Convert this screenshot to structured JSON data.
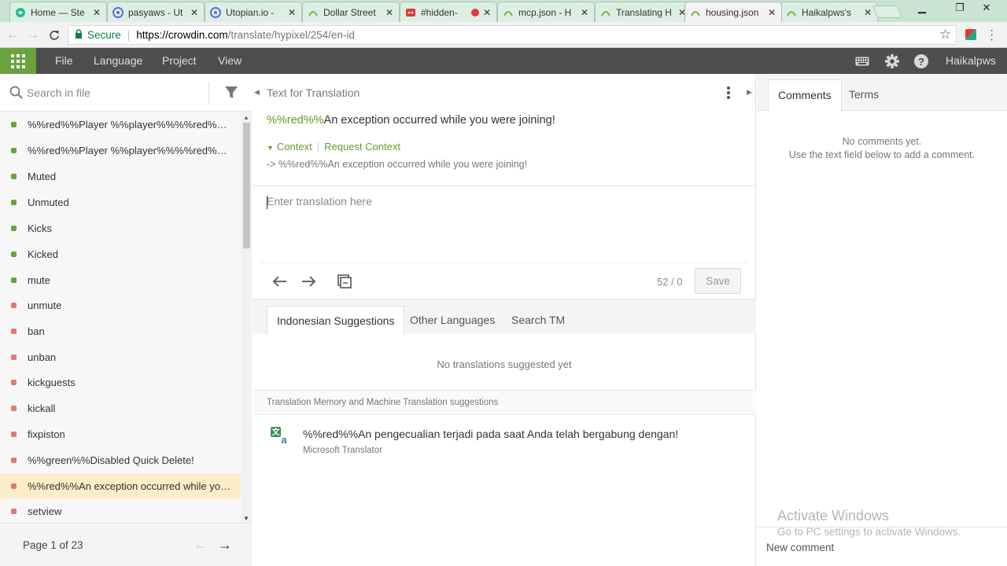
{
  "browser": {
    "tabs": [
      {
        "title": "Home — Ste",
        "icon": "steemit-icon",
        "color": "#1fbf8f"
      },
      {
        "title": "pasyaws - Ut",
        "icon": "utopian-icon",
        "color": "#5a6de0"
      },
      {
        "title": "Utopian.io -",
        "icon": "utopian-icon",
        "color": "#5a6de0"
      },
      {
        "title": "Dollar Street",
        "icon": "crowdin-icon",
        "color": "#7cb342"
      },
      {
        "title": "#hidden-",
        "icon": "discord-icon",
        "color": "#e53935"
      },
      {
        "title": "mcp.json - H",
        "icon": "crowdin-icon",
        "color": "#7cb342"
      },
      {
        "title": "Translating H",
        "icon": "crowdin-icon",
        "color": "#7cb342"
      },
      {
        "title": "housing.json",
        "icon": "crowdin-icon",
        "color": "#7cb342"
      },
      {
        "title": "Haikalpws's",
        "icon": "crowdin-icon",
        "color": "#7cb342"
      }
    ],
    "active_tab": 7,
    "secure_label": "Secure",
    "url_host": "https://crowdin.com",
    "url_path": "/translate/hypixel/254/en-id"
  },
  "toolbar": {
    "menu": [
      "File",
      "Language",
      "Project",
      "View"
    ],
    "username": "Haikalpws",
    "accent": "#6aa33e"
  },
  "left": {
    "search_placeholder": "Search in file",
    "strings": [
      {
        "text": "%%red%%Player %%player%%%%red%% is ...",
        "status": "green"
      },
      {
        "text": "%%red%%Player %%player%%%%red%% is ...",
        "status": "green"
      },
      {
        "text": "Muted",
        "status": "green"
      },
      {
        "text": "Unmuted",
        "status": "green"
      },
      {
        "text": "Kicks",
        "status": "green"
      },
      {
        "text": "Kicked",
        "status": "green"
      },
      {
        "text": "mute",
        "status": "green"
      },
      {
        "text": "unmute",
        "status": "red"
      },
      {
        "text": "ban",
        "status": "red"
      },
      {
        "text": "unban",
        "status": "red"
      },
      {
        "text": "kickguests",
        "status": "red"
      },
      {
        "text": "kickall",
        "status": "red"
      },
      {
        "text": "fixpiston",
        "status": "red"
      },
      {
        "text": "%%green%%Disabled Quick Delete!",
        "status": "red"
      },
      {
        "text": "%%red%%An exception occurred while you ...",
        "status": "red",
        "selected": true
      },
      {
        "text": "setview",
        "status": "red"
      }
    ],
    "page_label": "Page 1 of 23"
  },
  "center": {
    "header": "Text for Translation",
    "source_tag": "%%red%%",
    "source_text": "An exception occurred while you were joining!",
    "context_label": "Context",
    "request_context": "Request Context",
    "context_line": "-> %%red%%An exception occurred while you were joining!",
    "translation_placeholder": "Enter translation here",
    "counter": "52 / 0",
    "save_label": "Save",
    "suggestion_tabs": [
      "Indonesian Suggestions",
      "Other Languages",
      "Search TM"
    ],
    "no_suggestions": "No translations suggested yet",
    "tm_label": "Translation Memory and Machine Translation suggestions",
    "mt_text": "%%red%%An pengecualian terjadi pada saat Anda telah bergabung dengan!",
    "mt_source": "Microsoft Translator"
  },
  "right": {
    "tabs": [
      "Comments",
      "Terms"
    ],
    "no_comments": "No comments yet.",
    "hint": "Use the text field below to add a comment.",
    "new_comment_placeholder": "New comment"
  },
  "watermark": {
    "line1": "Activate Windows",
    "line2": "Go to PC settings to activate Windows."
  }
}
